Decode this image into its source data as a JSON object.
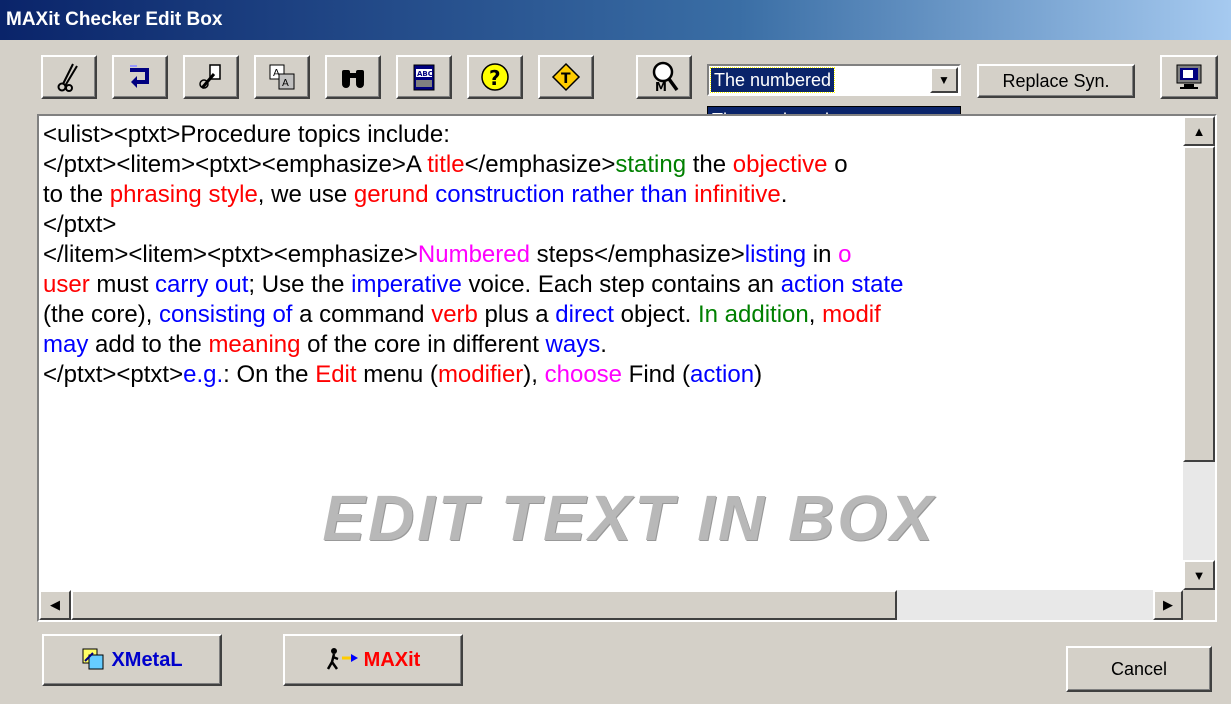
{
  "window": {
    "title": "MAXit Checker Edit Box"
  },
  "toolbar": {
    "buttons": [
      "cut-icon",
      "return-icon",
      "eraser-icon",
      "translate-icon",
      "binoculars-icon",
      "dictionary-icon",
      "help-icon",
      "thesaurus-icon",
      "magnify-maxit-icon"
    ],
    "combo_value": "The numbered",
    "dropdown_option": "The numbered",
    "replace_label": "Replace Syn.",
    "monitor_icon": "monitor-icon"
  },
  "editor": {
    "lines": [
      [
        [
          "<ulist><ptxt>Procedure topics include:",
          "k"
        ]
      ],
      [
        [
          "</ptxt><litem><ptxt><emphasize>A ",
          "k"
        ],
        [
          "title",
          "r"
        ],
        [
          "</emphasize>",
          "k"
        ],
        [
          "stating",
          "g"
        ],
        [
          " the ",
          "k"
        ],
        [
          "objective",
          "r"
        ],
        [
          " o",
          "k"
        ]
      ],
      [
        [
          "to the ",
          "k"
        ],
        [
          "phrasing style",
          "r"
        ],
        [
          ", we use ",
          "k"
        ],
        [
          "gerund",
          "r"
        ],
        [
          " ",
          "k"
        ],
        [
          "construction rather than",
          "b"
        ],
        [
          " ",
          "k"
        ],
        [
          "infinitive",
          "r"
        ],
        [
          ".",
          "k"
        ]
      ],
      [
        [
          "</ptxt>",
          "k"
        ]
      ],
      [
        [
          "</litem><litem><ptxt><emphasize>",
          "k"
        ],
        [
          "Numbered",
          "m"
        ],
        [
          " steps</emphasize>",
          "k"
        ],
        [
          "listing",
          "b"
        ],
        [
          " in ",
          "k"
        ],
        [
          "o",
          "m"
        ]
      ],
      [
        [
          "user",
          "r"
        ],
        [
          " must ",
          "k"
        ],
        [
          "carry out",
          "b"
        ],
        [
          "; Use the ",
          "k"
        ],
        [
          "imperative",
          "b"
        ],
        [
          " voice. Each step contains an ",
          "k"
        ],
        [
          "action state",
          "b"
        ]
      ],
      [
        [
          "(the core), ",
          "k"
        ],
        [
          "consisting of",
          "b"
        ],
        [
          " a command ",
          "k"
        ],
        [
          "verb",
          "r"
        ],
        [
          " plus a ",
          "k"
        ],
        [
          "direct",
          "b"
        ],
        [
          " object. ",
          "k"
        ],
        [
          "In addition",
          "g"
        ],
        [
          ", ",
          "k"
        ],
        [
          "modif",
          "r"
        ]
      ],
      [
        [
          "may",
          "b"
        ],
        [
          " add to the ",
          "k"
        ],
        [
          "meaning",
          "r"
        ],
        [
          " of the core in different ",
          "k"
        ],
        [
          "ways",
          "b"
        ],
        [
          ".",
          "k"
        ]
      ],
      [
        [
          "</ptxt><ptxt>",
          "k"
        ],
        [
          "e.g.",
          "b"
        ],
        [
          ": On the ",
          "k"
        ],
        [
          "Edit",
          "r"
        ],
        [
          " menu (",
          "k"
        ],
        [
          "modifier",
          "r"
        ],
        [
          "), ",
          "k"
        ],
        [
          "choose",
          "m"
        ],
        [
          " Find (",
          "k"
        ],
        [
          "action",
          "b"
        ],
        [
          ")",
          "k"
        ]
      ]
    ],
    "watermark": "EDIT TEXT IN BOX"
  },
  "bottom": {
    "xmetal_label": "XMetaL",
    "maxit_label": "MAXit",
    "cancel_label": "Cancel"
  },
  "colors": {
    "keyword_red": "#ff0000",
    "keyword_blue": "#0000ff",
    "keyword_green": "#008000",
    "keyword_magenta": "#ff00ff",
    "title_bar": "#0a246a"
  }
}
